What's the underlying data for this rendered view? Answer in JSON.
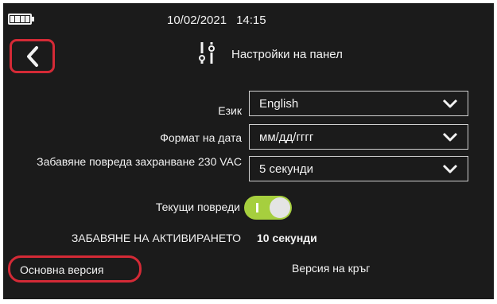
{
  "status_bar": {
    "date": "10/02/2021",
    "time": "14:15",
    "battery_icon": "battery-full-icon"
  },
  "header": {
    "back_icon": "chevron-left-icon",
    "title_icon": "sliders-icon",
    "title": "Настройки на панел"
  },
  "settings": {
    "language": {
      "label": "Език",
      "value": "English"
    },
    "date_format": {
      "label": "Формат на дата",
      "value": "мм/дд/гггг"
    },
    "fault_delay": {
      "label": "Забавяне повреда захранване 230 VAC",
      "value": "5 секунди"
    },
    "current_faults": {
      "label": "Текущи повреди",
      "enabled": true
    },
    "activation_delay": {
      "label": "ЗАБАВЯНЕ НА АКТИВИРАНЕТО",
      "value": "10 секунди"
    }
  },
  "footer": {
    "base_version": "Основна версия",
    "circuit_version": "Версия на кръг"
  },
  "colors": {
    "background": "#1b1b1b",
    "text": "#f2f2f2",
    "highlight": "#d42a36",
    "toggle_on": "#a6cf3e"
  }
}
